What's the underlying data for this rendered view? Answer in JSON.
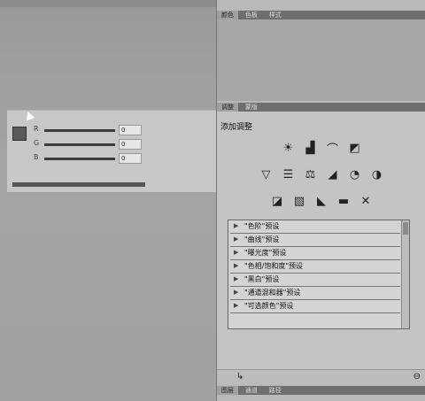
{
  "top_panel": {
    "tabs": [
      "颜色",
      "色板",
      "样式"
    ]
  },
  "color_panel": {
    "sliders": [
      {
        "label": "R",
        "value": "0"
      },
      {
        "label": "G",
        "value": "0"
      },
      {
        "label": "B",
        "value": "0"
      }
    ],
    "foreground_color": "#5a5a5a"
  },
  "adjustments_panel": {
    "tabs": [
      "调整",
      "蒙版"
    ],
    "title": "添加调整",
    "icon_rows": [
      [
        "brightness-contrast-icon",
        "levels-icon",
        "curves-icon",
        "exposure-icon"
      ],
      [
        "vibrance-icon",
        "hue-saturation-icon",
        "color-balance-icon",
        "black-white-icon",
        "photo-filter-icon",
        "channel-mixer-icon"
      ],
      [
        "invert-icon",
        "posterize-icon",
        "threshold-icon",
        "gradient-map-icon",
        "selective-color-icon"
      ]
    ],
    "presets": [
      "\"色阶\"预设",
      "\"曲线\"预设",
      "\"曝光度\"预设",
      "\"色相/饱和度\"预设",
      "\"黑白\"预设",
      "\"通道混和器\"预设",
      "\"可选颜色\"预设"
    ]
  },
  "bottom_panel": {
    "tabs": [
      "图层",
      "通道",
      "路径"
    ]
  }
}
